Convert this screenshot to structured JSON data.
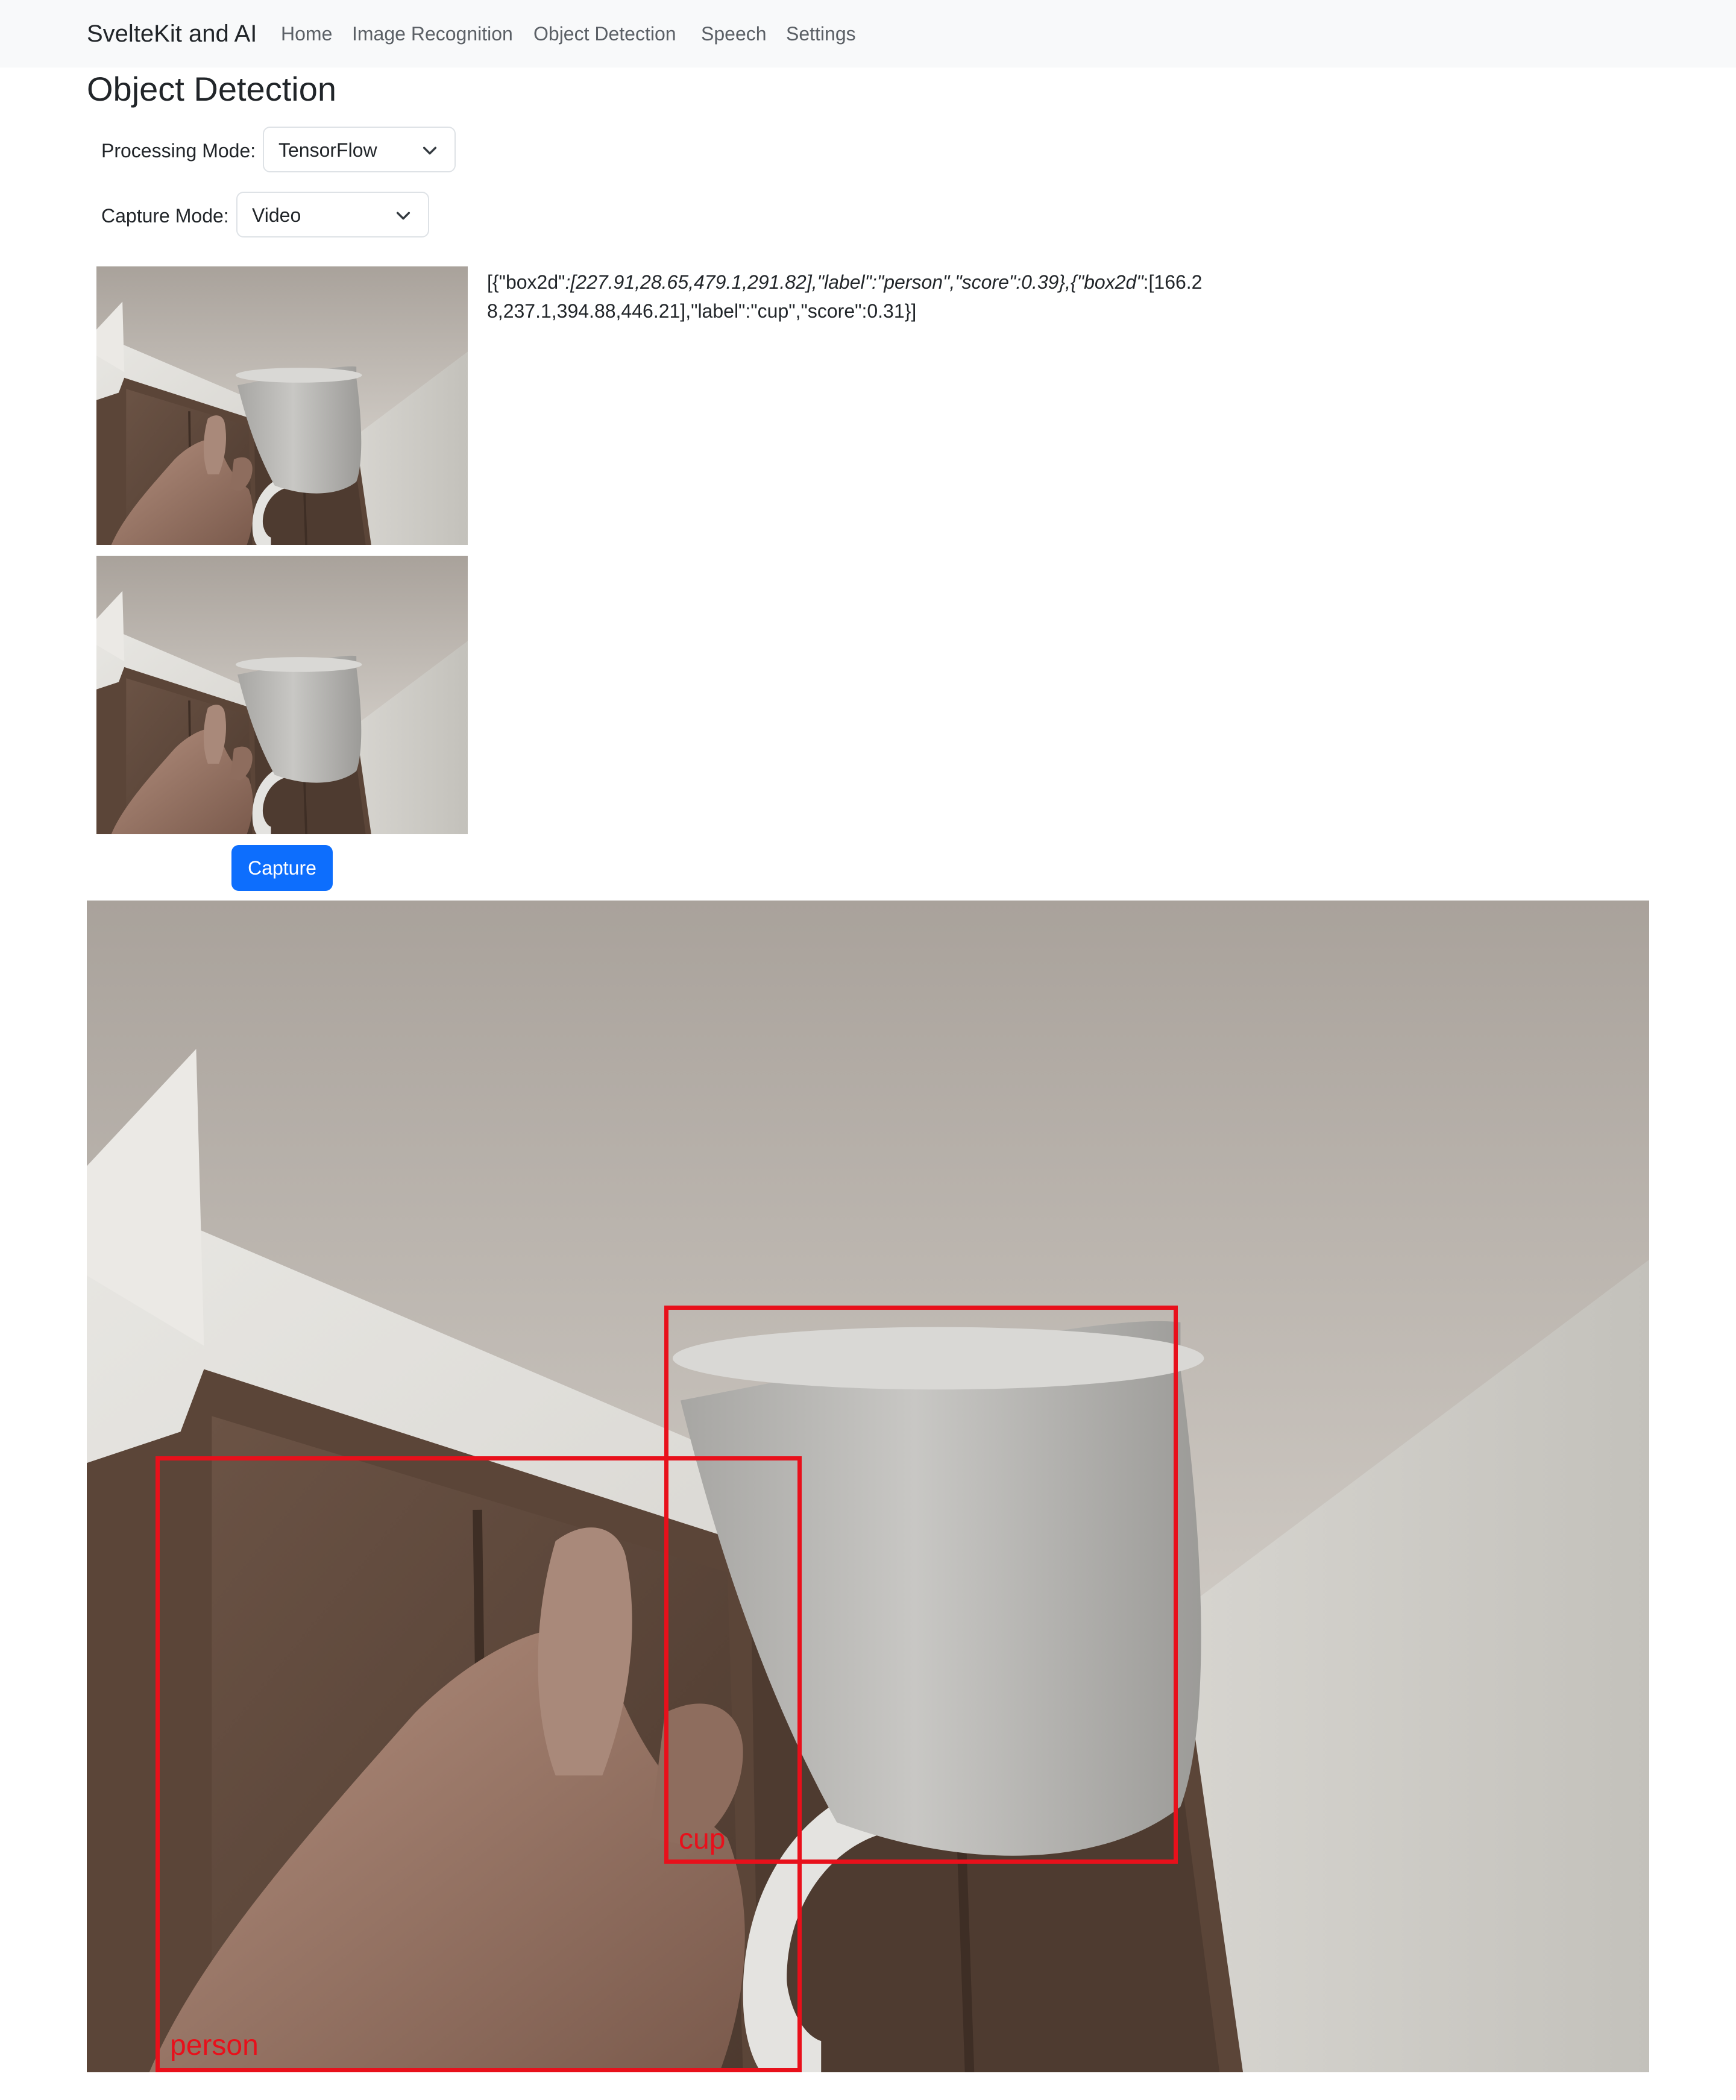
{
  "navbar": {
    "brand": "SvelteKit and AI",
    "links": [
      "Home",
      "Image Recognition",
      "Object Detection",
      "Speech",
      "Settings"
    ]
  },
  "page": {
    "title": "Object Detection"
  },
  "form": {
    "processing_label": "Processing Mode:",
    "processing_value": "TensorFlow",
    "capture_label": "Capture Mode:",
    "capture_value": "Video"
  },
  "capture_button": "Capture",
  "result": {
    "part1": "[{\"box2d\"",
    "part2": ":[227.91,28.65,479.1,291.82],\"label\":\"person\",\"score\":0.39},{\"box2d\"",
    "part3": ":[166.28,237.1,394.88,446.21],\"label\":\"cup\",\"score\":0.31}]"
  },
  "detections": [
    {
      "label": "person",
      "score": 0.39,
      "box2d": [
        227.91,
        28.65,
        479.1,
        291.82
      ]
    },
    {
      "label": "cup",
      "score": 0.31,
      "box2d": [
        166.28,
        237.1,
        394.88,
        446.21
      ]
    }
  ],
  "colors": {
    "navbar_bg": "#f8f9fa",
    "primary": "#0d6efd",
    "detection_box": "#e8101b"
  },
  "icons": {
    "select_arrow": "chevron-down-icon"
  }
}
